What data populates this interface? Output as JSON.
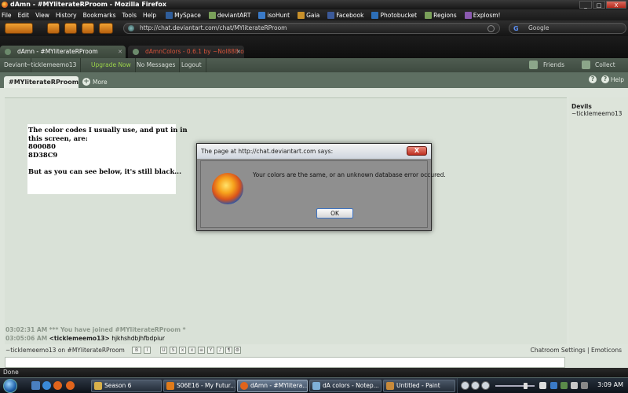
{
  "window": {
    "title": "dAmn - #MYliterateRProom - Mozilla Firefox",
    "min_label": "_",
    "max_label": "□",
    "close_label": "X"
  },
  "menu": [
    "File",
    "Edit",
    "View",
    "History",
    "Bookmarks",
    "Tools",
    "Help"
  ],
  "bookmarks": [
    {
      "label": "MySpace",
      "color": "#2f5d9a"
    },
    {
      "label": "deviantART",
      "color": "#7aa05a"
    },
    {
      "label": "isoHunt",
      "color": "#3a7ac8"
    },
    {
      "label": "Gaia",
      "color": "#c8902a"
    },
    {
      "label": "Facebook",
      "color": "#3b5998"
    },
    {
      "label": "Photobucket",
      "color": "#2d6fb8"
    },
    {
      "label": "Regions",
      "color": "#7aa05a"
    },
    {
      "label": "Explosm!",
      "color": "#8b5ab0"
    }
  ],
  "nav": {
    "url": "http://chat.deviantart.com/chat/MYliterateRProom",
    "search_placeholder": "Google"
  },
  "tabs": [
    {
      "label": "dAmn - #MYliterateRProom",
      "active": true
    },
    {
      "label": "dAmnColors - 0.6.1 by ~Nol888 o...",
      "active": false
    }
  ],
  "da_bar": {
    "deviant_label": "Deviant",
    "username": "~ticklemeemo13",
    "upgrade": "Upgrade Now",
    "messages": "No Messages",
    "logout": "Logout",
    "friends": "Friends",
    "collect": "Collect"
  },
  "room": {
    "tab_label": "#MYliterateRProom",
    "more_label": "More",
    "help_label": "Help",
    "question_glyph": "?"
  },
  "members": {
    "heading": "Devils",
    "names": [
      "~ticklemeemo13"
    ]
  },
  "note": {
    "lines": [
      "The color codes I usually use, and put in in",
      "this screen, are:",
      "800080",
      "8D38C9",
      "",
      "But as you can see below, it's still black..."
    ]
  },
  "messages": [
    {
      "time": "03:02:31 AM",
      "text": "*** You have joined #MYliterateRProom *"
    },
    {
      "time": "03:05:06 AM",
      "nick": "<ticklemeemo13>",
      "text": "hjkhshdbjhfbdpiur"
    }
  ],
  "controls": {
    "room_label": "~ticklemeemo13 on #MYliterateRProom",
    "settings": "Chatroom Settings",
    "separator": "|",
    "emoticons": "Emoticons",
    "format_buttons": [
      "B",
      "I",
      "U",
      "S",
      "x",
      "x",
      "≡",
      "Y",
      "♪",
      "¶",
      "⚙"
    ]
  },
  "status": {
    "text": "Done"
  },
  "taskbar": {
    "tasks": [
      {
        "label": "Season 6",
        "color": "#d8b04a",
        "current": false
      },
      {
        "label": "S06E16 - My Futur...",
        "color": "#e07b1a",
        "current": false
      },
      {
        "label": "dAmn - #MYlitera...",
        "color": "#e0641c",
        "current": true
      },
      {
        "label": "dA colors - Notep...",
        "color": "#7fb0d8",
        "current": false
      },
      {
        "label": "Untitled - Paint",
        "color": "#c88a3a",
        "current": false
      }
    ],
    "clock": "3:09 AM",
    "volume_level": 0.8
  },
  "dialog": {
    "title": "The page at http://chat.deviantart.com says:",
    "message": "Your colors are the same, or an unknown database error occured.",
    "ok_label": "OK",
    "close_label": "X"
  }
}
